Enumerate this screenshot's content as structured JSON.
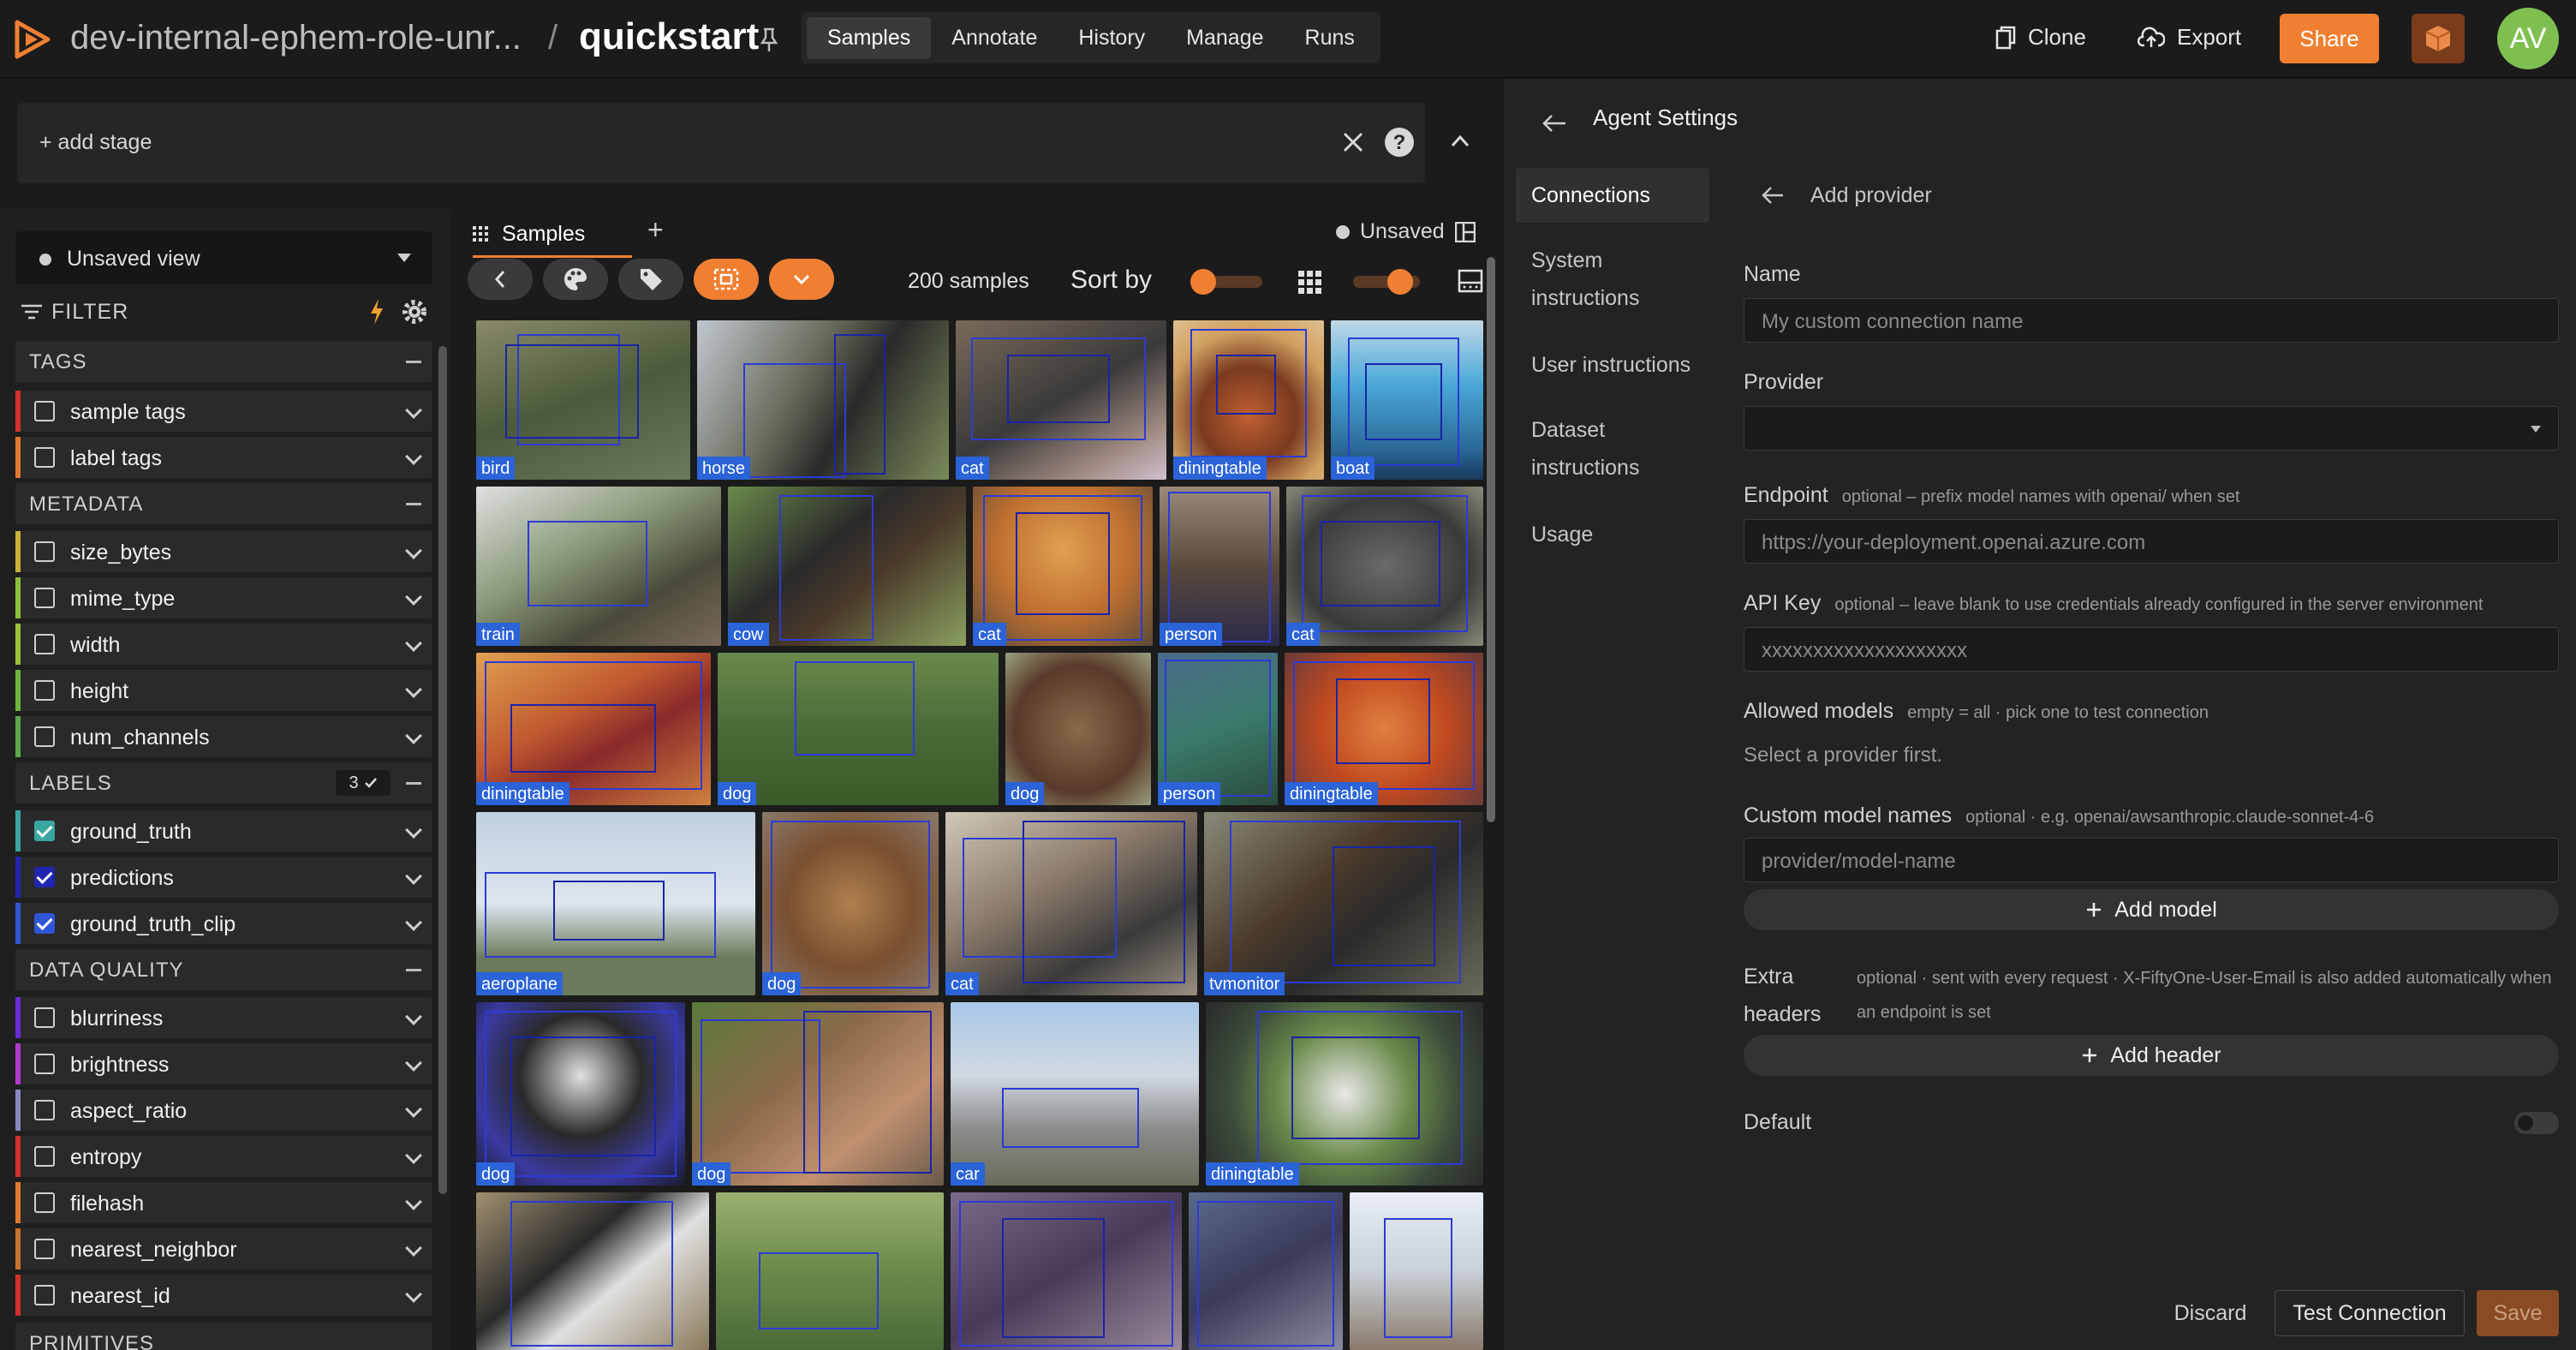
{
  "header": {
    "dataset_name": "dev-internal-ephem-role-unr...",
    "separator": "/",
    "project_name": "quickstart",
    "tabs": [
      "Samples",
      "Annotate",
      "History",
      "Manage",
      "Runs"
    ],
    "active_tab": "Samples",
    "clone_label": "Clone",
    "export_label": "Export",
    "share_label": "Share",
    "avatar_initials": "AV"
  },
  "viewbar": {
    "add_stage_label": "+ add stage"
  },
  "sidebar": {
    "view_select": "Unsaved view",
    "filter_label": "FILTER",
    "sections": [
      {
        "title": "TAGS",
        "rows": [
          {
            "label": "sample tags",
            "color": "#d4312b",
            "checked": false
          },
          {
            "label": "label tags",
            "color": "#e07a2e",
            "checked": false
          }
        ]
      },
      {
        "title": "METADATA",
        "rows": [
          {
            "label": "size_bytes",
            "color": "#c8b03a",
            "checked": false
          },
          {
            "label": "mime_type",
            "color": "#8bbf3a",
            "checked": false
          },
          {
            "label": "width",
            "color": "#9bc23a",
            "checked": false
          },
          {
            "label": "height",
            "color": "#6fb33a",
            "checked": false
          },
          {
            "label": "num_channels",
            "color": "#5aa84a",
            "checked": false
          }
        ]
      },
      {
        "title": "LABELS",
        "badge": "3",
        "rows": [
          {
            "label": "ground_truth",
            "color": "#3aa6a0",
            "checked": true,
            "check_color": "#3aa6a0"
          },
          {
            "label": "predictions",
            "color": "#2026b0",
            "checked": true,
            "check_color": "#2026b0"
          },
          {
            "label": "ground_truth_clip",
            "color": "#2f56d6",
            "checked": true,
            "check_color": "#2f56d6"
          }
        ]
      },
      {
        "title": "DATA QUALITY",
        "rows": [
          {
            "label": "blurriness",
            "color": "#6a2bd6",
            "checked": false
          },
          {
            "label": "brightness",
            "color": "#b03ad0",
            "checked": false
          },
          {
            "label": "aspect_ratio",
            "color": "#8a88c0",
            "checked": false
          },
          {
            "label": "entropy",
            "color": "#d4312b",
            "checked": false
          },
          {
            "label": "filehash",
            "color": "#e07a2e",
            "checked": false
          },
          {
            "label": "nearest_neighbor",
            "color": "#c8722e",
            "checked": false
          },
          {
            "label": "nearest_id",
            "color": "#d4312b",
            "checked": false
          }
        ]
      },
      {
        "title": "PRIMITIVES",
        "rows": []
      }
    ]
  },
  "samples": {
    "tab_label": "Samples",
    "unsaved_label": "Unsaved",
    "count_label": "200 samples",
    "sort_label": "Sort by",
    "tiles": [
      {
        "label": "bird"
      },
      {
        "label": "horse"
      },
      {
        "label": "cat"
      },
      {
        "label": "diningtable"
      },
      {
        "label": "boat"
      },
      {
        "label": "train"
      },
      {
        "label": "cow"
      },
      {
        "label": "cat"
      },
      {
        "label": "person"
      },
      {
        "label": "cat"
      },
      {
        "label": "diningtable"
      },
      {
        "label": "dog"
      },
      {
        "label": "dog"
      },
      {
        "label": "person"
      },
      {
        "label": "diningtable"
      },
      {
        "label": "aeroplane"
      },
      {
        "label": "dog"
      },
      {
        "label": "cat"
      },
      {
        "label": "tvmonitor"
      },
      {
        "label": "dog"
      },
      {
        "label": "dog"
      },
      {
        "label": "car"
      },
      {
        "label": "diningtable"
      },
      {
        "label": ""
      },
      {
        "label": ""
      },
      {
        "label": ""
      },
      {
        "label": ""
      },
      {
        "label": ""
      }
    ]
  },
  "agent": {
    "title": "Agent Settings",
    "nav": [
      "Connections",
      "System instructions",
      "User instructions",
      "Dataset instructions",
      "Usage"
    ],
    "active_nav": "Connections",
    "sub_title": "Add provider",
    "name_label": "Name",
    "name_placeholder": "My custom connection name",
    "provider_label": "Provider",
    "provider_value": "",
    "endpoint_label": "Endpoint",
    "endpoint_hint": "optional – prefix model names with openai/ when set",
    "endpoint_placeholder": "https://your-deployment.openai.azure.com",
    "apikey_label": "API Key",
    "apikey_hint": "optional – leave blank to use credentials already configured in the server environment",
    "apikey_placeholder": "xxxxxxxxxxxxxxxxxxxx",
    "allowed_label": "Allowed models",
    "allowed_hint": "empty = all · pick one to test connection",
    "allowed_empty": "Select a provider first.",
    "custom_label": "Custom model names",
    "custom_hint": "optional · e.g. openai/awsanthropic.claude-sonnet-4-6",
    "custom_placeholder": "provider/model-name",
    "add_model_label": "Add model",
    "extra_label": "Extra headers",
    "extra_hint": "optional · sent with every request · X-FiftyOne-User-Email is also added automatically when an endpoint is set",
    "add_header_label": "Add header",
    "default_label": "Default",
    "default_on": false,
    "discard_label": "Discard",
    "test_label": "Test Connection",
    "save_label": "Save"
  }
}
